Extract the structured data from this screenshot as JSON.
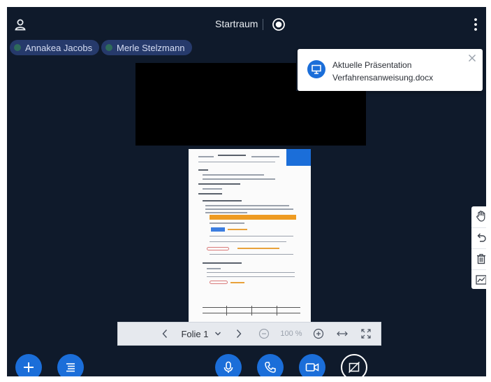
{
  "header": {
    "room_title": "Startraum"
  },
  "participants": [
    {
      "name": "Annakea Jacobs"
    },
    {
      "name": "Merle Stelzmann"
    }
  ],
  "notification": {
    "title": "Aktuelle Präsentation",
    "file": "Verfahrensanweisung.docx"
  },
  "presentation_controls": {
    "slide_label": "Folie 1",
    "zoom": "100 %"
  },
  "icons": {
    "user": "user-icon",
    "record": "record-icon",
    "more": "more-vertical-icon",
    "presentation": "presentation-icon",
    "close": "close-icon",
    "hand": "hand-pan-icon",
    "undo": "undo-icon",
    "delete": "trash-icon",
    "chart": "chart-icon",
    "prev": "chevron-left-icon",
    "next": "chevron-right-icon",
    "dropdown": "chevron-down-icon",
    "zoom_out": "zoom-out-icon",
    "zoom_in": "zoom-in-icon",
    "fit_width": "fit-width-icon",
    "fullscreen": "fullscreen-icon",
    "add": "plus-icon",
    "list": "list-icon",
    "mic": "microphone-icon",
    "phone": "phone-icon",
    "camera": "camera-icon",
    "screenshare": "screenshare-off-icon"
  },
  "colors": {
    "background": "#0f1a2b",
    "accent": "#1b6ed9",
    "chip": "#263a6b"
  }
}
